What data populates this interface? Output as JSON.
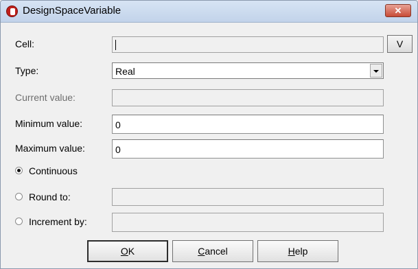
{
  "window": {
    "title": "DesignSpaceVariable",
    "close_glyph": "✕",
    "app_icon": "app-logo-icon"
  },
  "form": {
    "cell": {
      "label": "Cell:",
      "value": "",
      "button_label": "V"
    },
    "type": {
      "label": "Type:",
      "selected": "Real"
    },
    "current_value": {
      "label": "Current value:",
      "value": ""
    },
    "minimum_value": {
      "label": "Minimum value:",
      "value": "0"
    },
    "maximum_value": {
      "label": "Maximum value:",
      "value": "0"
    },
    "options": [
      {
        "label": "Continuous",
        "checked": true
      },
      {
        "label": "Round to:",
        "checked": false,
        "value": ""
      },
      {
        "label": "Increment by:",
        "checked": false,
        "value": ""
      }
    ]
  },
  "buttons": {
    "ok": {
      "mnemonic": "O",
      "rest": "K"
    },
    "cancel": {
      "mnemonic": "C",
      "rest": "ancel"
    },
    "help": {
      "mnemonic": "H",
      "rest": "elp"
    }
  }
}
